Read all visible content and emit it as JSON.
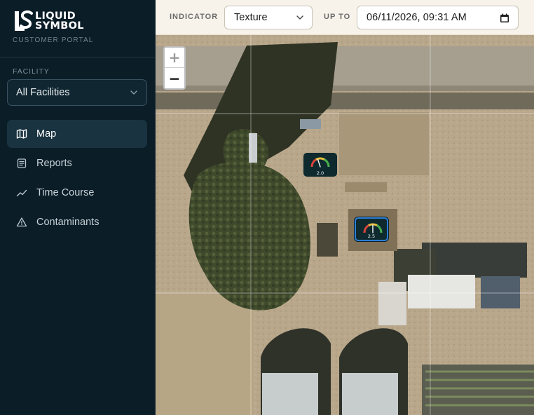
{
  "brand": {
    "name_line1": "LIQUID",
    "name_line2": "SYMBOL",
    "tagline": "CUSTOMER PORTAL"
  },
  "sidebar": {
    "facility_label": "FACILITY",
    "facility_selected": "All Facilities",
    "nav": [
      {
        "label": "Map",
        "icon": "map-icon",
        "active": true
      },
      {
        "label": "Reports",
        "icon": "reports-icon",
        "active": false
      },
      {
        "label": "Time Course",
        "icon": "trend-line-icon",
        "active": false
      },
      {
        "label": "Contaminants",
        "icon": "warning-triangle-icon",
        "active": false
      }
    ]
  },
  "toolbar": {
    "indicator_label": "INDICATOR",
    "indicator_selected": "Texture",
    "upto_label": "UP TO",
    "date_value": "06/11/2026, 09:31 AM"
  },
  "map": {
    "zoom_in": "+",
    "zoom_out": "−",
    "markers": [
      {
        "value": "2.0",
        "fraction": 0.4,
        "selected": false
      },
      {
        "value": "2.5",
        "fraction": 0.5,
        "selected": true
      }
    ]
  },
  "colors": {
    "sidebar_bg": "#0b1d27",
    "active_nav_bg": "#1a3340",
    "topbar_bg": "#f7f3ea",
    "marker_bg": "#0e2a2e",
    "selected_marker_border": "#2d7fd6"
  }
}
